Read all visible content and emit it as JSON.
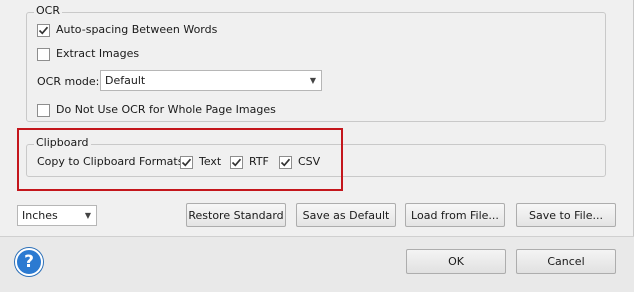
{
  "ocr": {
    "group_label": "OCR",
    "auto_spacing": {
      "label": "Auto-spacing Between Words",
      "checked": true
    },
    "extract_images": {
      "label": "Extract Images",
      "checked": false
    },
    "mode_label": "OCR mode:",
    "mode_value": "Default",
    "no_ocr_whole_page": {
      "label": "Do Not Use OCR for Whole Page Images",
      "checked": false
    }
  },
  "clipboard": {
    "group_label": "Clipboard",
    "formats_label": "Copy to Clipboard Formats:",
    "formats": [
      {
        "label": "Text",
        "checked": true
      },
      {
        "label": "RTF",
        "checked": true
      },
      {
        "label": "CSV",
        "checked": true
      }
    ]
  },
  "units": {
    "value": "Inches"
  },
  "actions": {
    "restore_standard": "Restore Standard",
    "save_as_default": "Save as Default",
    "load_from_file": "Load from File...",
    "save_to_file": "Save to File..."
  },
  "dialog": {
    "help_symbol": "?",
    "ok": "OK",
    "cancel": "Cancel"
  },
  "colors": {
    "highlight": "#c4161c",
    "help_blue": "#2b7ad1"
  }
}
